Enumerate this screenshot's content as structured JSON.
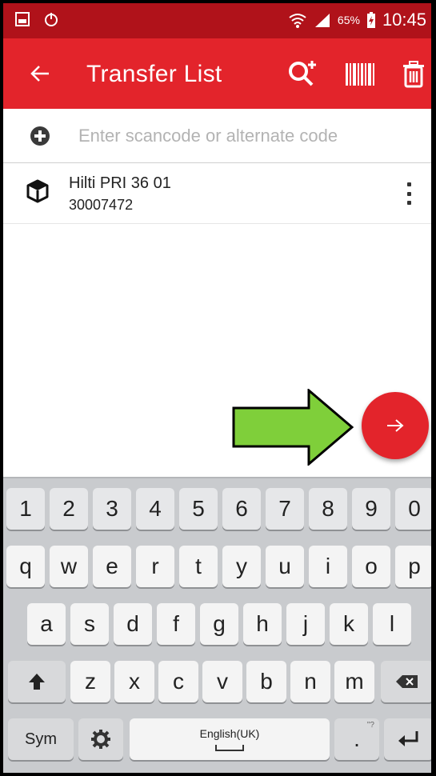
{
  "status_bar": {
    "battery_percent": "65%",
    "time": "10:45"
  },
  "toolbar": {
    "title": "Transfer List",
    "icons": [
      "arrow-left-icon",
      "search-plus-icon",
      "barcode-icon",
      "trash-icon"
    ]
  },
  "search": {
    "placeholder": "Enter scancode or alternate code",
    "value": ""
  },
  "list": {
    "items": [
      {
        "name": "Hilti PRI 36 01",
        "code": "30007472",
        "icon": "package-icon"
      }
    ]
  },
  "fab": {
    "icon": "arrow-right-icon"
  },
  "colors": {
    "statusbar": "#b0121a",
    "toolbar": "#e3242b",
    "fab": "#e3242b",
    "annotation_arrow": "#7fcf3a"
  },
  "keyboard": {
    "row_numbers": [
      "1",
      "2",
      "3",
      "4",
      "5",
      "6",
      "7",
      "8",
      "9",
      "0"
    ],
    "row_top": [
      "q",
      "w",
      "e",
      "r",
      "t",
      "y",
      "u",
      "i",
      "o",
      "p"
    ],
    "row_middle": [
      "a",
      "s",
      "d",
      "f",
      "g",
      "h",
      "j",
      "k",
      "l"
    ],
    "row_bottom": [
      "z",
      "x",
      "c",
      "v",
      "b",
      "n",
      "m"
    ],
    "sym_label": "Sym",
    "space_label": "English(UK)",
    "period_label": ".",
    "period_hint": "\"?"
  }
}
